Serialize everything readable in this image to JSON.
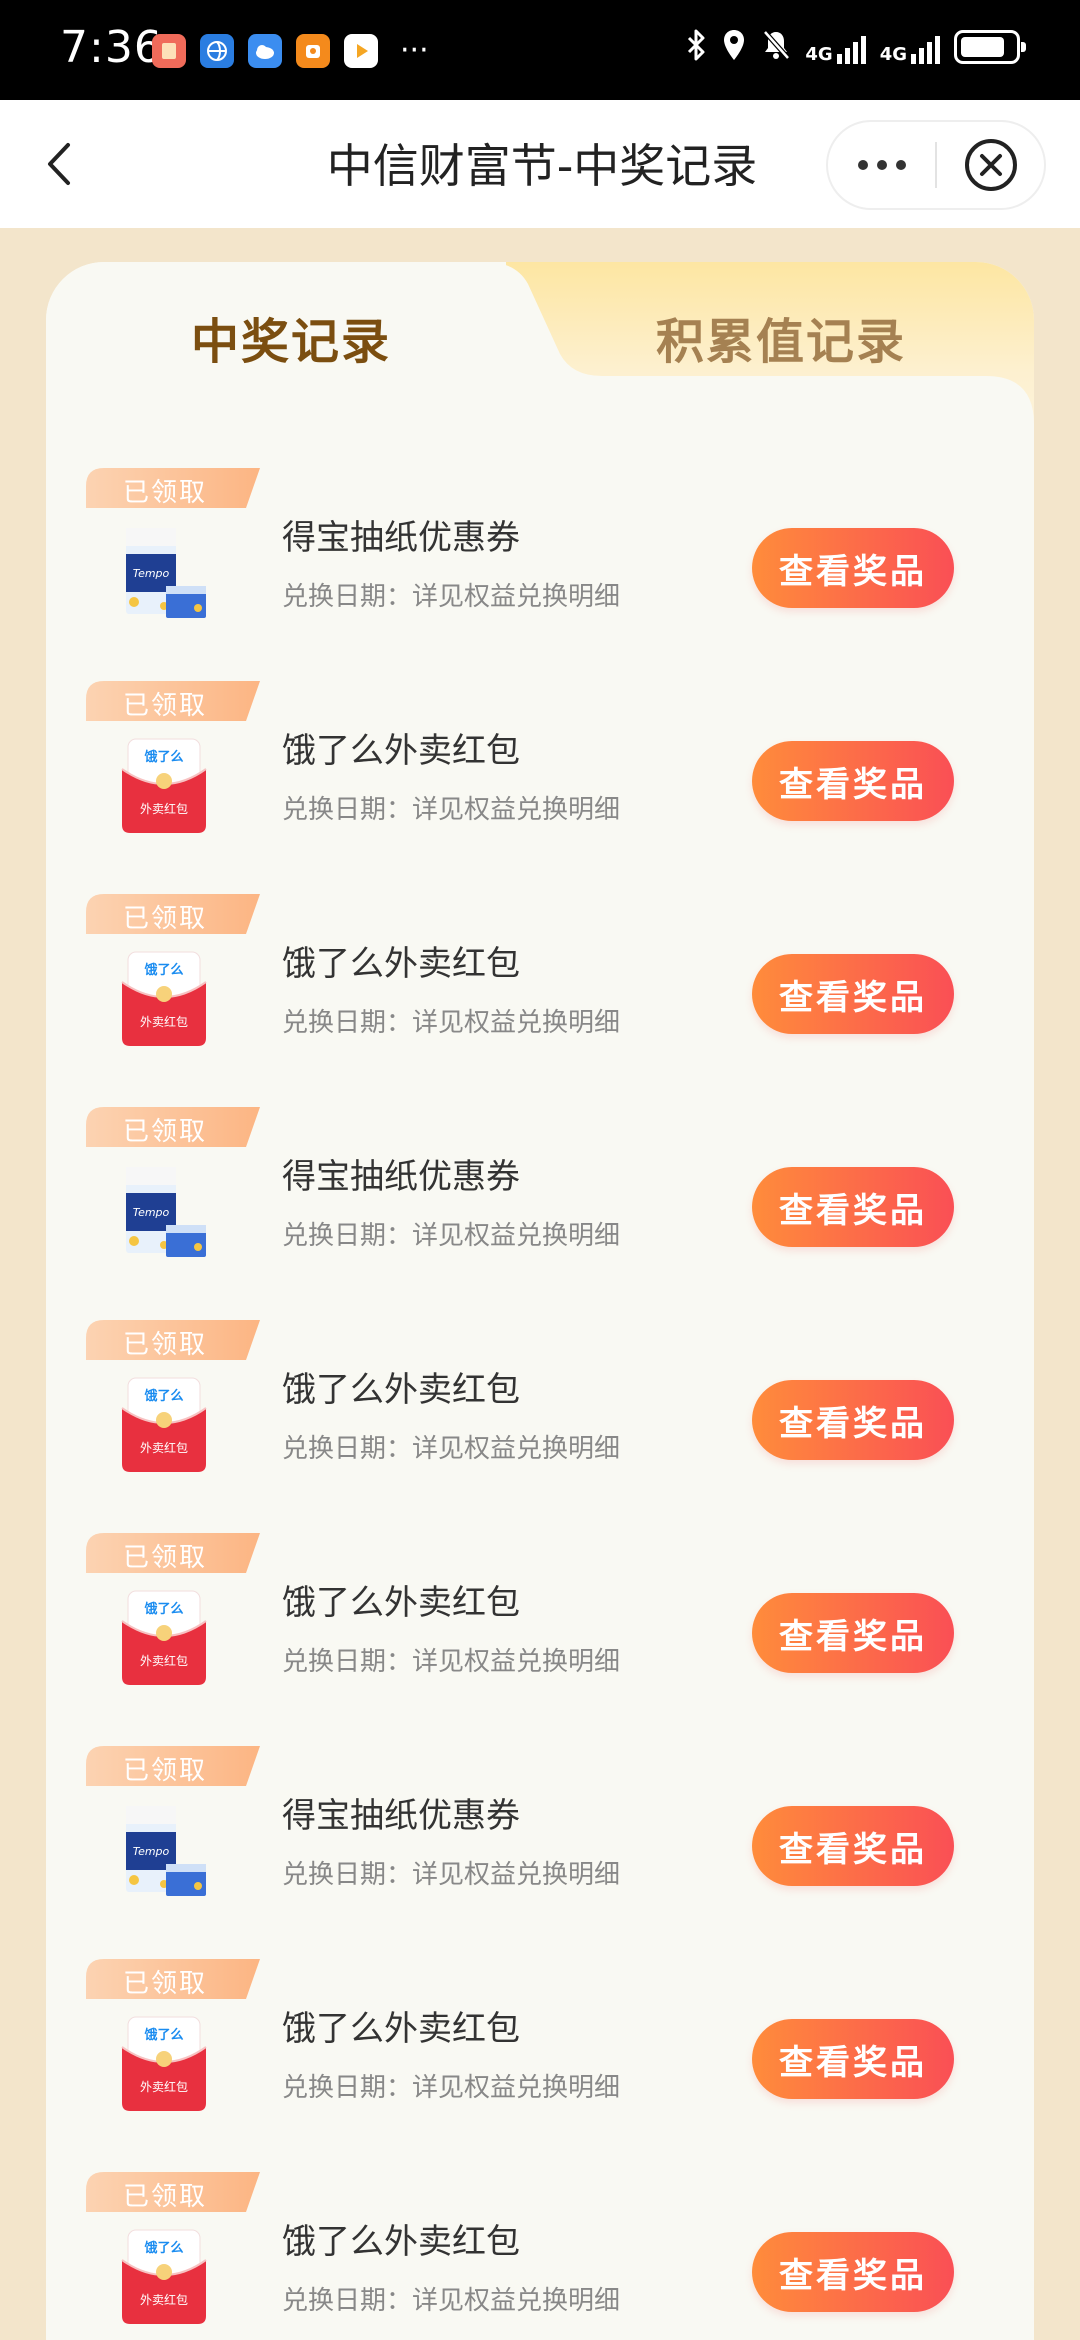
{
  "status_bar": {
    "time": "7:36",
    "network_1": "4G",
    "network_2": "4G",
    "more": "···"
  },
  "nav": {
    "title": "中信财富节-中奖记录"
  },
  "tabs": [
    {
      "label": "中奖记录",
      "active": true
    },
    {
      "label": "积累值记录",
      "active": false
    }
  ],
  "records": [
    {
      "badge": "已领取",
      "title": "得宝抽纸优惠券",
      "subtitle": "兑换日期：详见权益兑换明细",
      "button": "查看奖品",
      "icon": "tissue-icon"
    },
    {
      "badge": "已领取",
      "title": "饿了么外卖红包",
      "subtitle": "兑换日期：详见权益兑换明细",
      "button": "查看奖品",
      "icon": "red-packet-icon"
    },
    {
      "badge": "已领取",
      "title": "饿了么外卖红包",
      "subtitle": "兑换日期：详见权益兑换明细",
      "button": "查看奖品",
      "icon": "red-packet-icon"
    },
    {
      "badge": "已领取",
      "title": "得宝抽纸优惠券",
      "subtitle": "兑换日期：详见权益兑换明细",
      "button": "查看奖品",
      "icon": "tissue-icon"
    },
    {
      "badge": "已领取",
      "title": "饿了么外卖红包",
      "subtitle": "兑换日期：详见权益兑换明细",
      "button": "查看奖品",
      "icon": "red-packet-icon"
    },
    {
      "badge": "已领取",
      "title": "饿了么外卖红包",
      "subtitle": "兑换日期：详见权益兑换明细",
      "button": "查看奖品",
      "icon": "red-packet-icon"
    },
    {
      "badge": "已领取",
      "title": "得宝抽纸优惠券",
      "subtitle": "兑换日期：详见权益兑换明细",
      "button": "查看奖品",
      "icon": "tissue-icon"
    },
    {
      "badge": "已领取",
      "title": "饿了么外卖红包",
      "subtitle": "兑换日期：详见权益兑换明细",
      "button": "查看奖品",
      "icon": "red-packet-icon"
    },
    {
      "badge": "已领取",
      "title": "饿了么外卖红包",
      "subtitle": "兑换日期：详见权益兑换明细",
      "button": "查看奖品",
      "icon": "red-packet-icon"
    }
  ],
  "icon_text": {
    "eleme_logo": "饿了么",
    "packet_label": "外卖红包"
  },
  "colors": {
    "page_bg": "#f3e5cb",
    "card_bg": "#f9f9f3",
    "active_tab_text": "#7b4e10",
    "inactive_tab_text": "#a58152",
    "button_gradient_start": "#ff8c3b",
    "button_gradient_end": "#fa4f55",
    "badge_color": "#fbb98c"
  }
}
